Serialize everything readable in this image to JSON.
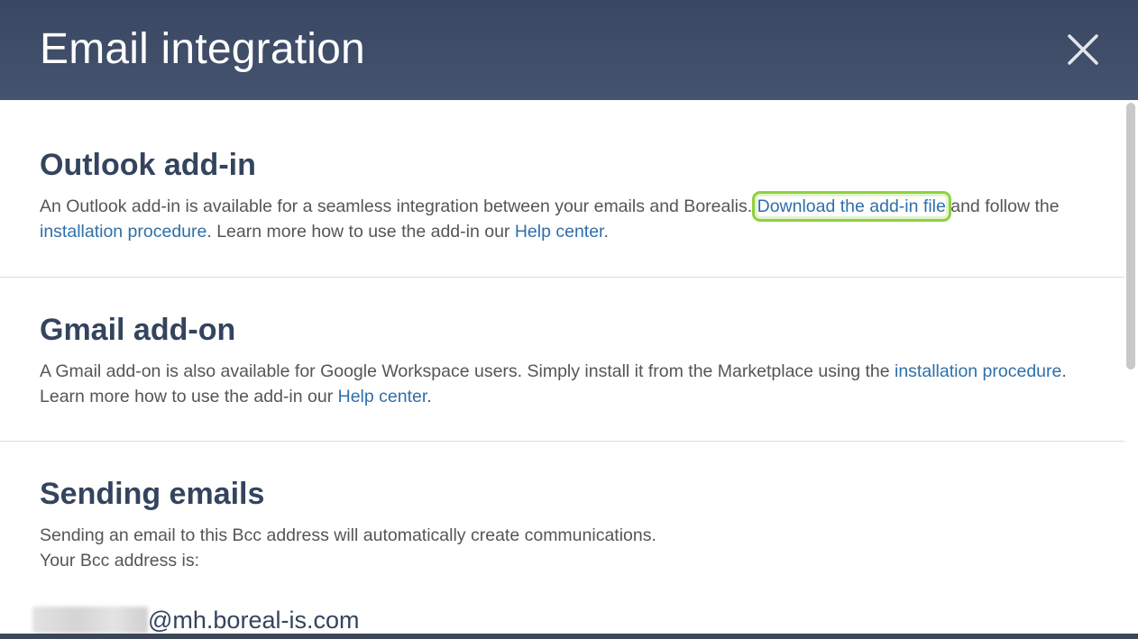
{
  "dialog": {
    "title": "Email integration",
    "close_icon": "close-icon"
  },
  "outlook": {
    "heading": "Outlook add-in",
    "text_1": "An Outlook add-in is available for a seamless integration between your emails and Borealis. ",
    "link_download": "Download the add-in file",
    "text_2": " and follow the ",
    "link_installation": "installation procedure",
    "text_3": ". Learn more how to use the add-in our ",
    "link_help": "Help center",
    "text_4": "."
  },
  "gmail": {
    "heading": "Gmail add-on",
    "text_1": "A Gmail add-on is also available for Google Workspace users. Simply install it from the Marketplace using the ",
    "link_installation": "installation procedure",
    "text_2": ". Learn more how to use the add-in our ",
    "link_help": "Help center",
    "text_3": "."
  },
  "sending": {
    "heading": "Sending emails",
    "line_1": "Sending an email to this Bcc address will automatically create communications.",
    "line_2": "Your Bcc address is:",
    "bcc_domain": "@mh.boreal-is.com"
  },
  "colors": {
    "header_bg": "#3a4762",
    "heading": "#34445e",
    "link": "#2f6fa9",
    "highlight": "#8fd13f"
  }
}
